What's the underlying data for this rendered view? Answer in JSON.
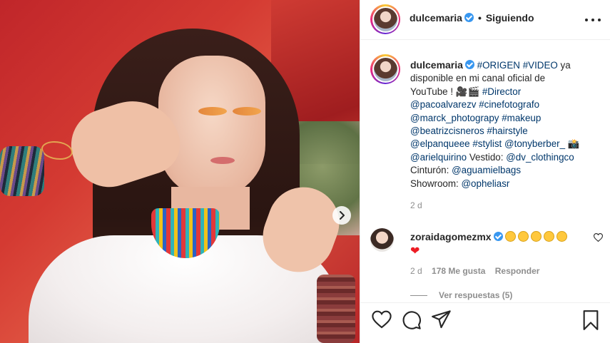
{
  "post": {
    "author": "dulcemaria",
    "follow_state": "Siguiendo",
    "dot": "•"
  },
  "caption": {
    "username": "dulcemaria",
    "lines": [
      [
        {
          "t": "#ORIGEN",
          "tag": true
        },
        {
          "t": " "
        },
        {
          "t": "#VIDEO",
          "tag": true
        },
        {
          "t": " ya"
        }
      ],
      [
        {
          "t": "disponible en mi canal oficial de"
        }
      ],
      [
        {
          "t": "YouTube ! 🎥🎬 "
        },
        {
          "t": "#Director",
          "tag": true
        }
      ],
      [
        {
          "t": "@pacoalvarezv",
          "tag": true
        },
        {
          "t": " "
        },
        {
          "t": "#cinefotografo",
          "tag": true
        }
      ],
      [
        {
          "t": "@marck_photograpy",
          "tag": true
        },
        {
          "t": " "
        },
        {
          "t": "#makeup",
          "tag": true
        }
      ],
      [
        {
          "t": "@beatrizcisneros",
          "tag": true
        },
        {
          "t": " "
        },
        {
          "t": "#hairstyle",
          "tag": true
        }
      ],
      [
        {
          "t": "@elpanqueee",
          "tag": true
        },
        {
          "t": " "
        },
        {
          "t": "#stylist",
          "tag": true
        },
        {
          "t": " "
        },
        {
          "t": "@tonyberber_",
          "tag": true
        },
        {
          "t": " 📸"
        }
      ],
      [
        {
          "t": "@arielquirino",
          "tag": true
        },
        {
          "t": " Vestido: "
        },
        {
          "t": "@dv_clothingco",
          "tag": true
        }
      ],
      [
        {
          "t": "Cinturón: "
        },
        {
          "t": "@aguamielbags",
          "tag": true
        }
      ],
      [
        {
          "t": "Showroom: "
        },
        {
          "t": "@opheliasr",
          "tag": true
        }
      ]
    ],
    "time": "2 d"
  },
  "comment": {
    "username": "zoraidagomezmx",
    "emoji_count": 5,
    "heart": "❤",
    "time": "2 d",
    "likes": "178 Me gusta",
    "reply_label": "Responder",
    "view_replies": "Ver respuestas (5)"
  },
  "icons": {
    "next": "chevron-right-icon",
    "more": "more-horizontal-icon",
    "like": "heart-icon",
    "comment": "comment-icon",
    "share": "paper-plane-icon",
    "save": "bookmark-icon"
  },
  "colors": {
    "link": "#00376b",
    "verified": "#3897f0",
    "muted": "#8e8e8e",
    "text": "#262626"
  }
}
